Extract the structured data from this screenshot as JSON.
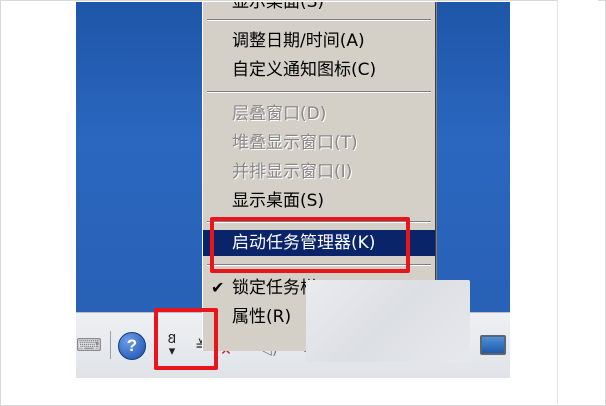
{
  "menu": {
    "items": [
      {
        "label": "显示桌面(S)",
        "state": "partial"
      },
      {
        "label": "调整日期/时间(A)",
        "state": "enabled"
      },
      {
        "label": "自定义通知图标(C)",
        "state": "enabled"
      },
      {
        "label": "层叠窗口(D)",
        "state": "disabled"
      },
      {
        "label": "堆叠显示窗口(T)",
        "state": "disabled"
      },
      {
        "label": "并排显示窗口(I)",
        "state": "disabled"
      },
      {
        "label": "显示桌面(S)",
        "state": "enabled"
      },
      {
        "label": "启动任务管理器(K)",
        "state": "selected"
      },
      {
        "label": "锁定任务栏(L)",
        "state": "checked",
        "check": "✔"
      },
      {
        "label": "属性(R)",
        "state": "enabled"
      }
    ]
  },
  "taskbar": {
    "help_label": "?",
    "lang_top": "𐐒",
    "lang_bottom": "▾",
    "tray_toggle": "≚",
    "icons": [
      "keyboard-icon",
      "help-icon",
      "language-bar-icon",
      "show-hidden-icons-toggle",
      "flag-icon",
      "volume-icon",
      "network-icon",
      "monitor-icon"
    ]
  },
  "colors": {
    "menu_bg": "#d4d0c8",
    "selection": "#0a246a",
    "highlight_box": "#e8161c",
    "desktop": "#2761b8"
  }
}
